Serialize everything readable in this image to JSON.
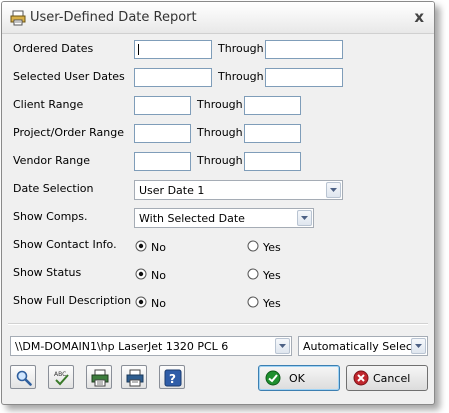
{
  "window": {
    "title": "User-Defined Date Report",
    "close_glyph": "x"
  },
  "ranges": [
    {
      "label": "Ordered Dates",
      "from": "",
      "through_label": "Through",
      "to": ""
    },
    {
      "label": "Selected User Dates",
      "from": "",
      "through_label": "Through",
      "to": ""
    },
    {
      "label": "Client Range",
      "from": "",
      "through_label": "Through",
      "to": ""
    },
    {
      "label": "Project/Order Range",
      "from": "",
      "through_label": "Through",
      "to": ""
    },
    {
      "label": "Vendor Range",
      "from": "",
      "through_label": "Through",
      "to": ""
    }
  ],
  "date_selection": {
    "label": "Date Selection",
    "value": "User Date 1"
  },
  "show_comps": {
    "label": "Show Comps.",
    "value": "With Selected Date"
  },
  "options": [
    {
      "label": "Show Contact Info.",
      "no": "No",
      "yes": "Yes",
      "selected": "No"
    },
    {
      "label": "Show Status",
      "no": "No",
      "yes": "Yes",
      "selected": "No"
    },
    {
      "label": "Show Full Description",
      "no": "No",
      "yes": "Yes",
      "selected": "No"
    }
  ],
  "printer": {
    "value": "\\\\DM-DOMAIN1\\hp LaserJet 1320 PCL 6"
  },
  "tray": {
    "value": "Automatically Select"
  },
  "toolbar": {
    "icons": [
      "search-icon",
      "spellcheck-icon",
      "print-preview-icon",
      "print-icon",
      "help-icon"
    ],
    "help_glyph": "?"
  },
  "buttons": {
    "ok": "OK",
    "cancel": "Cancel"
  },
  "colors": {
    "accent_border": "#7f9db9",
    "ok_green": "#1e8f2e",
    "cancel_red": "#c0262d"
  }
}
